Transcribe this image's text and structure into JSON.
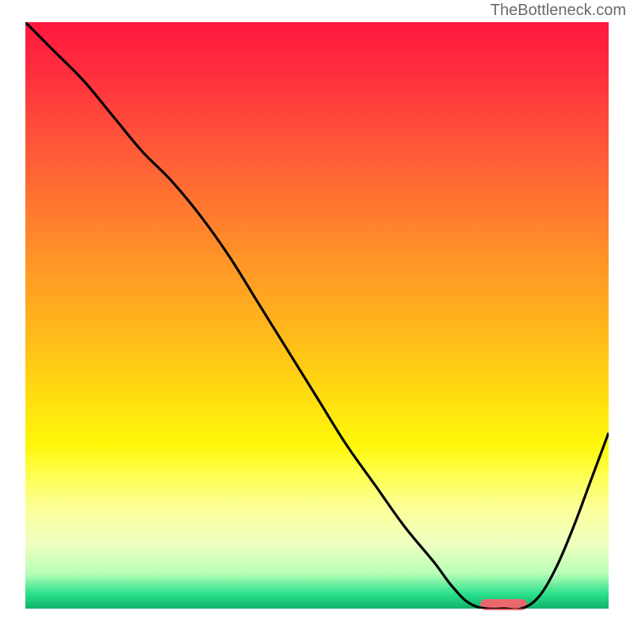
{
  "watermark": "TheBottleneck.com",
  "colors": {
    "curve_stroke": "#000000",
    "marker_fill": "#e8686e",
    "watermark_text": "#6a6a6a",
    "gradient_top": "#ff183f",
    "gradient_bottom": "#12b26c"
  },
  "chart_data": {
    "type": "line",
    "title": "",
    "xlabel": "",
    "ylabel": "",
    "xlim": [
      0,
      100
    ],
    "ylim": [
      0,
      100
    ],
    "x": [
      0,
      5,
      10,
      15,
      20,
      25,
      30,
      35,
      40,
      45,
      50,
      55,
      60,
      65,
      70,
      73,
      76,
      79,
      82,
      85,
      88,
      91,
      94,
      97,
      100
    ],
    "values": [
      100,
      95,
      90,
      84,
      78,
      73,
      67,
      60,
      52,
      44,
      36,
      28,
      21,
      14,
      8,
      4,
      1,
      0,
      0,
      0,
      2,
      7,
      14,
      22,
      30
    ],
    "marker": {
      "x_start": 78,
      "x_end": 86,
      "y": 0
    },
    "annotations": []
  }
}
